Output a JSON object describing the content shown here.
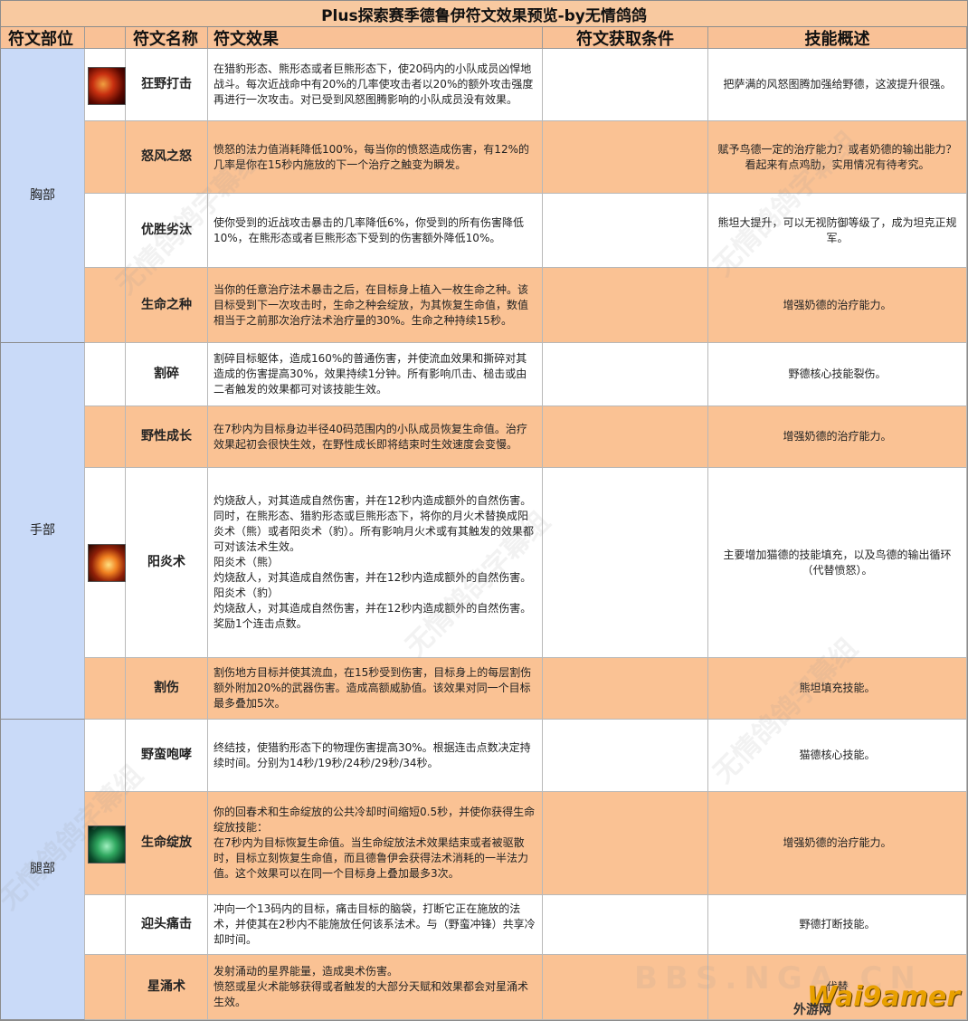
{
  "title": "Plus探索赛季德鲁伊符文效果预览-by无情鸽鸽",
  "headers": {
    "part": "符文部位",
    "name": "符文名称",
    "effect": "符文效果",
    "condition": "符文获取条件",
    "summary": "技能概述"
  },
  "parts": {
    "chest": "胸部",
    "hands": "手部",
    "legs": "腿部"
  },
  "rows": [
    {
      "name": "狂野打击",
      "effect": "在猎豹形态、熊形态或者巨熊形态下，使20码内的小队成员凶悍地战斗。每次近战命中有20%的几率使攻击者以20%的额外攻击强度再进行一次攻击。对已受到风怒图腾影响的小队成员没有效果。",
      "condition": "",
      "summary": "把萨满的风怒图腾加强给野德，这波提升很强。"
    },
    {
      "name": "怒风之怒",
      "effect": "愤怒的法力值消耗降低100%，每当你的愤怒造成伤害，有12%的几率是你在15秒内施放的下一个治疗之触变为瞬发。",
      "condition": "",
      "summary": "赋予鸟德一定的治疗能力？或者奶德的输出能力？看起来有点鸡肋，实用情况有待考究。"
    },
    {
      "name": "优胜劣汰",
      "effect": "使你受到的近战攻击暴击的几率降低6%，你受到的所有伤害降低10%，在熊形态或者巨熊形态下受到的伤害额外降低10%。",
      "condition": "",
      "summary": "熊坦大提升，可以无视防御等级了，成为坦克正规军。"
    },
    {
      "name": "生命之种",
      "effect": "当你的任意治疗法术暴击之后，在目标身上植入一枚生命之种。该目标受到下一次攻击时，生命之种会绽放，为其恢复生命值，数值相当于之前那次治疗法术治疗量的30%。生命之种持续15秒。",
      "condition": "",
      "summary": "增强奶德的治疗能力。"
    },
    {
      "name": "割碎",
      "effect": "割碎目标躯体，造成160%的普通伤害，并使流血效果和撕碎对其造成的伤害提高30%，效果持续1分钟。所有影响爪击、槌击或由二者触发的效果都可对该技能生效。",
      "condition": "",
      "summary": "野德核心技能裂伤。"
    },
    {
      "name": "野性成长",
      "effect": "在7秒内为目标身边半径40码范围内的小队成员恢复生命值。治疗效果起初会很快生效，在野性成长即将结束时生效速度会变慢。",
      "condition": "",
      "summary": "增强奶德的治疗能力。"
    },
    {
      "name": "阳炎术",
      "effect": "灼烧敌人，对其造成自然伤害，并在12秒内造成额外的自然伤害。\n同时，在熊形态、猎豹形态或巨熊形态下，将你的月火术替换成阳炎术（熊）或者阳炎术（豹）。所有影响月火术或有其触发的效果都可对该法术生效。\n阳炎术（熊）\n灼烧敌人，对其造成自然伤害，并在12秒内造成额外的自然伤害。\n阳炎术（豹）\n灼烧敌人，对其造成自然伤害，并在12秒内造成额外的自然伤害。奖励1个连击点数。",
      "condition": "",
      "summary": "主要增加猫德的技能填充，以及鸟德的输出循环（代替愤怒）。"
    },
    {
      "name": "割伤",
      "effect": "割伤地方目标并使其流血，在15秒受到伤害，目标身上的每层割伤额外附加20%的武器伤害。造成高额威胁值。该效果对同一个目标最多叠加5次。",
      "condition": "",
      "summary": "熊坦填充技能。"
    },
    {
      "name": "野蛮咆哮",
      "effect": "终结技，使猎豹形态下的物理伤害提高30%。根据连击点数决定持续时间。分别为14秒/19秒/24秒/29秒/34秒。",
      "condition": "",
      "summary": "猫德核心技能。"
    },
    {
      "name": "生命绽放",
      "effect": "你的回春术和生命绽放的公共冷却时间缩短0.5秒，并使你获得生命绽放技能：\n在7秒内为目标恢复生命值。当生命绽放法术效果结束或者被驱散时，目标立刻恢复生命值，而且德鲁伊会获得法术消耗的一半法力值。这个效果可以在同一个目标身上叠加最多3次。",
      "condition": "",
      "summary": "增强奶德的治疗能力。"
    },
    {
      "name": "迎头痛击",
      "effect": "冲向一个13码内的目标，痛击目标的脑袋，打断它正在施放的法术，并使其在2秒内不能施放任何该系法术。与（野蛮冲锋）共享冷却时间。",
      "condition": "",
      "summary": "野德打断技能。"
    },
    {
      "name": "星涌术",
      "effect": "发射涌动的星界能量，造成奥术伤害。\n愤怒或星火术能够获得或者触发的大部分天赋和效果都会对星涌术生效。",
      "condition": "",
      "summary": "代替"
    }
  ],
  "icons": [
    "fire-claw-icon",
    "sunfire-icon",
    "lifebloom-icon"
  ],
  "colors": {
    "title_bg": "#f8c9a0",
    "header_bg": "#f9c196",
    "part_bg": "#c9daf8",
    "orange_row": "#fac294",
    "white_row": "#ffffff"
  },
  "watermark": {
    "text": "无情鸽鸽字幕组",
    "site": "BBS.NGA.CN",
    "logo_text": "Wai9amer",
    "logo_sub": "外游网"
  }
}
